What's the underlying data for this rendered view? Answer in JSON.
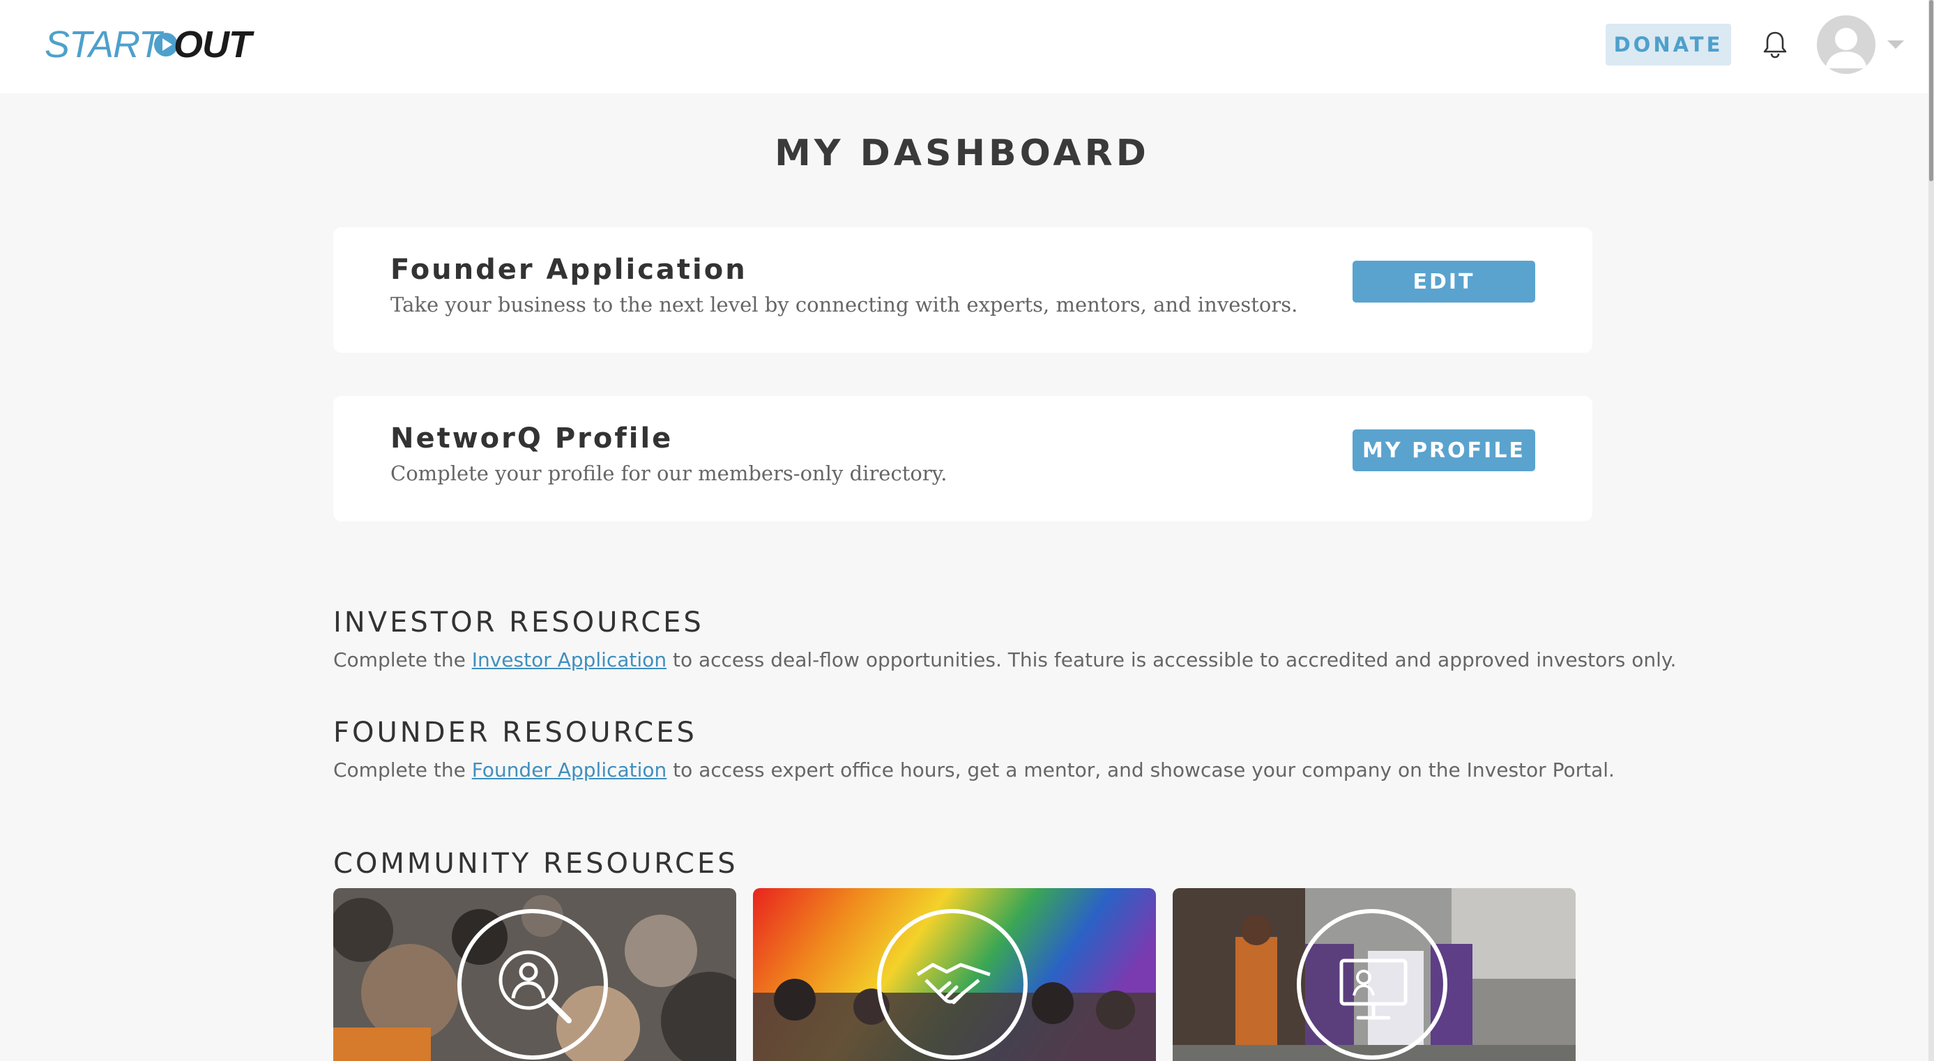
{
  "header": {
    "logo_start": "START",
    "logo_out": "OUT",
    "donate_label": "DONATE"
  },
  "page": {
    "title": "MY DASHBOARD"
  },
  "cards": [
    {
      "title": "Founder Application",
      "description": "Take your business to the next level by connecting with experts, mentors, and investors.",
      "button": "EDIT"
    },
    {
      "title": "NetworQ Profile",
      "description": "Complete your profile for our members-only directory.",
      "button": "MY PROFILE"
    }
  ],
  "investor": {
    "heading": "INVESTOR RESOURCES",
    "text_before": "Complete the ",
    "link": "Investor Application",
    "text_after": " to access deal-flow opportunities. This feature is accessible to accredited and approved investors only."
  },
  "founder": {
    "heading": "FOUNDER RESOURCES",
    "text_before": "Complete the ",
    "link": "Founder Application",
    "text_after": " to access expert office hours, get a mentor, and showcase your company on the Investor Portal."
  },
  "community": {
    "heading": "COMMUNITY RESOURCES",
    "tiles": [
      {
        "icon": "people-search-icon"
      },
      {
        "icon": "handshake-icon"
      },
      {
        "icon": "presentation-screen-icon"
      }
    ]
  },
  "colors": {
    "accent": "#5aa3cf",
    "link": "#3f8fbf",
    "donate_bg": "#dbe9f3",
    "background": "#f7f7f7"
  }
}
